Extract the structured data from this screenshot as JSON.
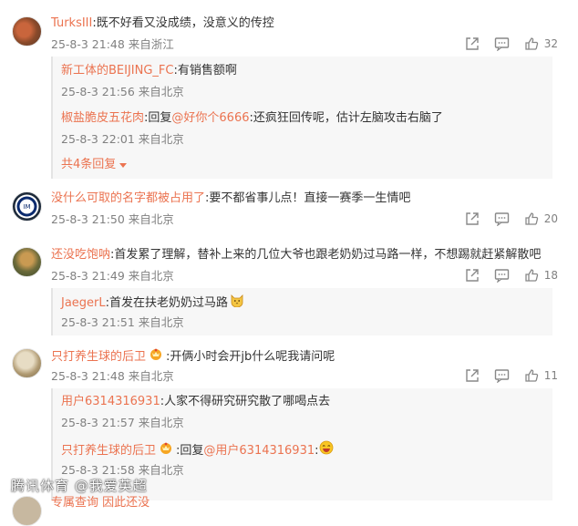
{
  "actions_icons": [
    "share-icon",
    "comment-icon",
    "like-icon"
  ],
  "colors": {
    "username": "#eb7350",
    "meta": "#808080",
    "reply_bg": "#f7f7f7"
  },
  "comments": [
    {
      "user": "TurksIII",
      "text": ":既不好看又没成绩，没意义的传控",
      "time": "25-8-3 21:48 来自浙江",
      "likes": "32",
      "replies": [
        {
          "user": "新工体的BEIJING_FC",
          "text": ":有销售额啊",
          "time": "25-8-3 21:56 来自北京"
        },
        {
          "user": "椒盐脆皮五花肉",
          "prefix": ":回复",
          "at": "@好你个6666",
          "text": ":还疯狂回传呢，估计左脑攻击右脑了",
          "time": "25-8-3 22:01 来自北京"
        }
      ],
      "more": "共4条回复"
    },
    {
      "user": "没什么可取的名字都被占用了",
      "text": ":要不都省事儿点！直接一赛季一生情吧",
      "time": "25-8-3 21:50 来自北京",
      "likes": "20"
    },
    {
      "user": "还没吃饱呐",
      "text": ":首发累了理解，替补上来的几位大爷也跟老奶奶过马路一样，不想踢就赶紧解散吧",
      "time": "25-8-3 21:49 来自北京",
      "likes": "18",
      "replies": [
        {
          "user": "JaegerL",
          "text": ":首发在扶老奶奶过马路",
          "time": "25-8-3 21:51 来自北京"
        }
      ]
    },
    {
      "user": "只打养生球的后卫",
      "text": ":开俩小时会开jb什么呢我请问呢",
      "time": "25-8-3 21:48 来自北京",
      "likes": "11",
      "replies": [
        {
          "user": "用户6314316931",
          "text": ":人家不得研究研究散了哪喝点去",
          "time": "25-8-3 21:57 来自北京"
        },
        {
          "user": "只打养生球的后卫",
          "prefix": ":回复",
          "at": "@用户6314316931",
          "text": ":",
          "time": "25-8-3 21:58 来自北京"
        }
      ]
    }
  ],
  "cut_off_text": "专属查询 因此还没",
  "watermark": "腾讯体育 @我爱英超"
}
